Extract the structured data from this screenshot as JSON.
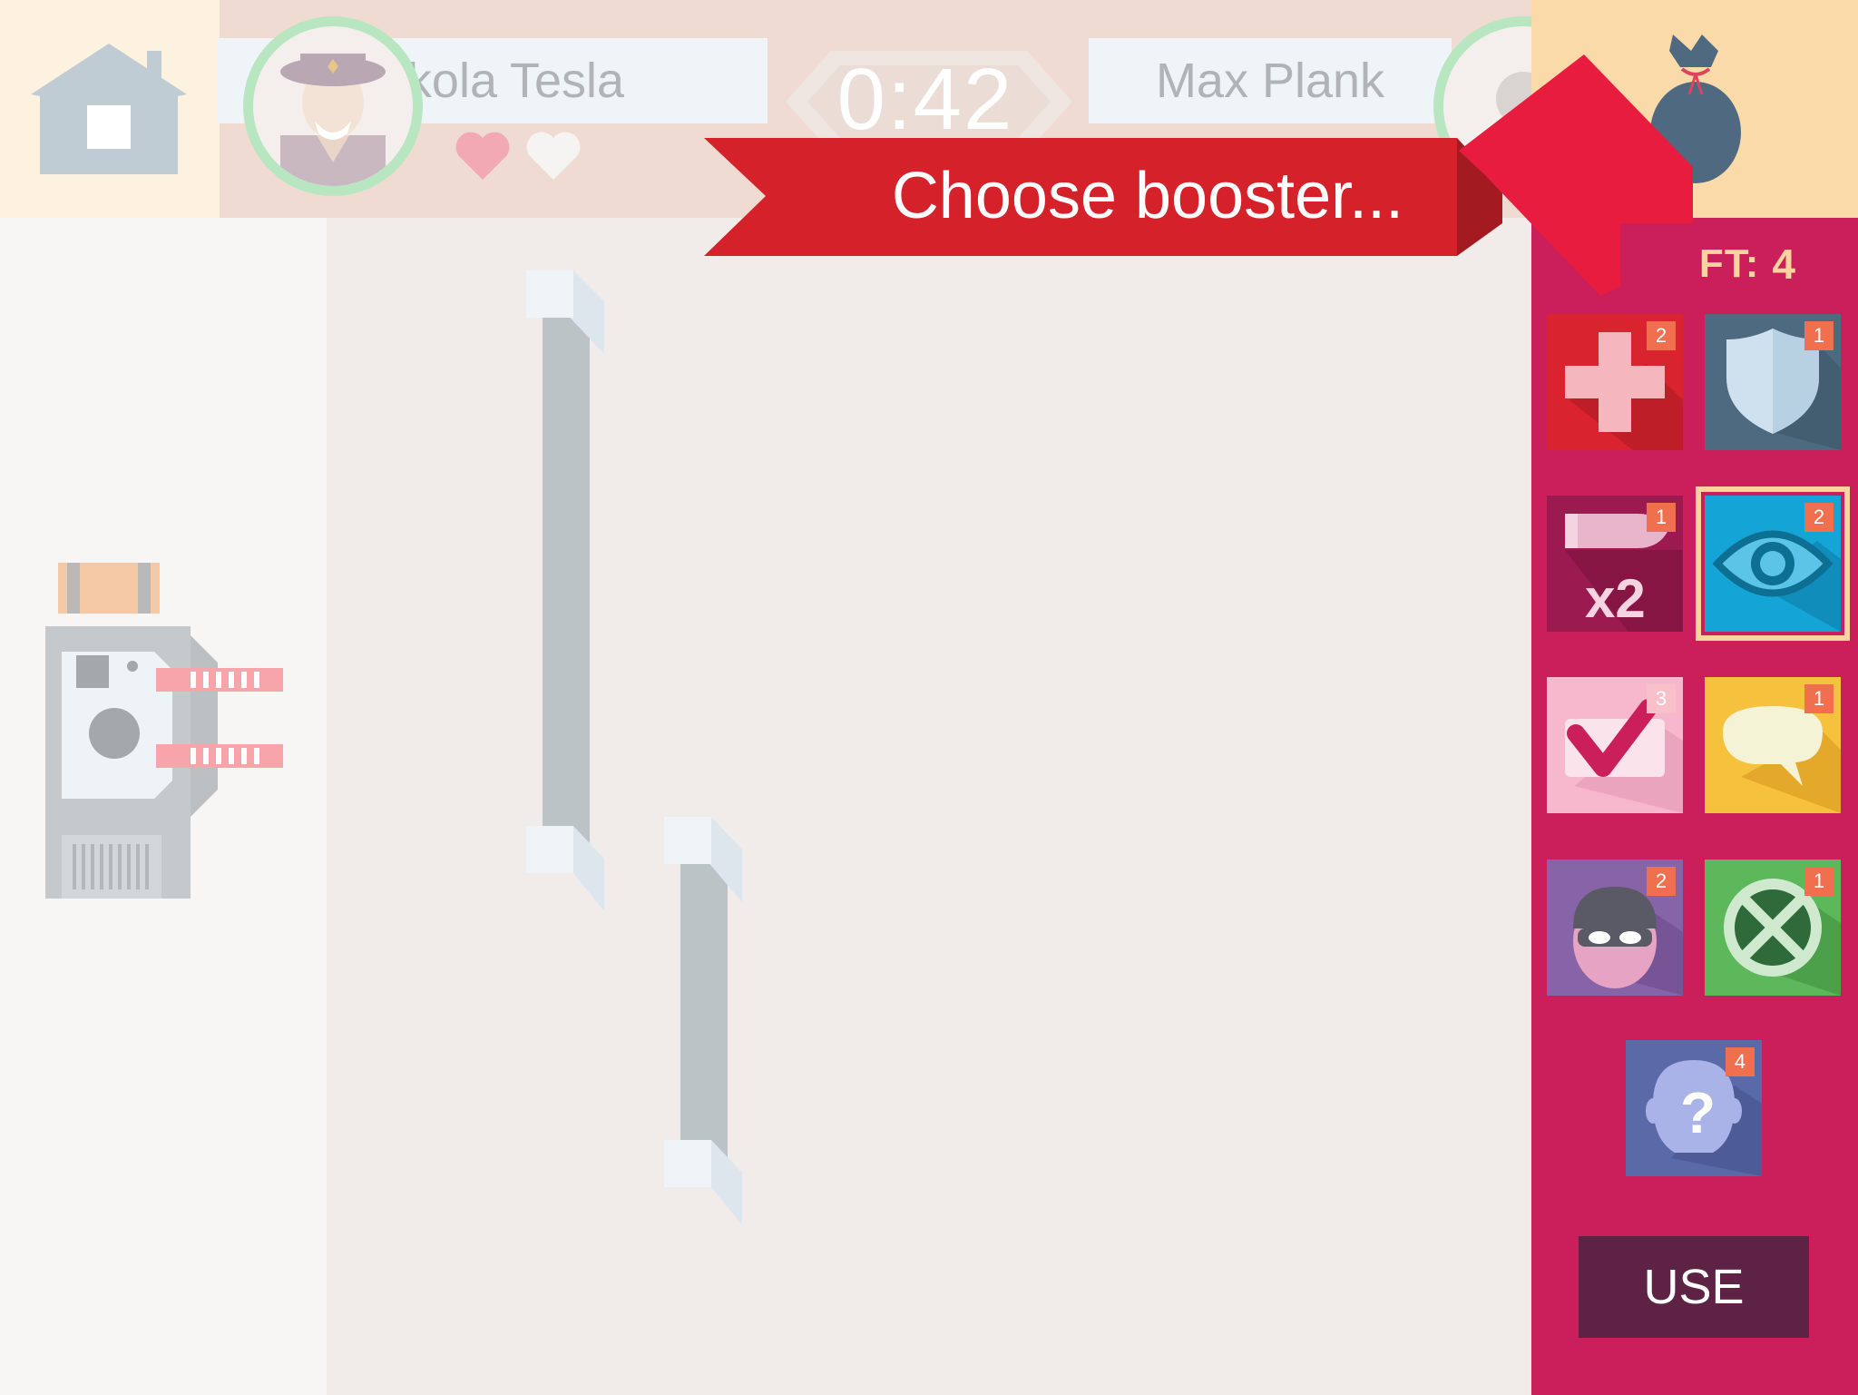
{
  "header": {
    "home_icon": "house-icon",
    "player1": {
      "name": "Nikola Tesla",
      "avatar": "officer-avatar",
      "hearts": [
        "full",
        "empty"
      ]
    },
    "timer": "0:42",
    "player2": {
      "name": "Max Plank",
      "avatar": "avatar"
    },
    "bag_icon": "money-bag-icon"
  },
  "banner": {
    "text": "Choose booster..."
  },
  "booster_panel": {
    "left_label": "FT:",
    "left_count": "4",
    "boosters": [
      {
        "icon": "medical-cross-icon",
        "count": "2",
        "color": "#d9232e"
      },
      {
        "icon": "shield-icon",
        "count": "1",
        "color": "#4e6a80"
      },
      {
        "icon": "x2-bullet-icon",
        "label": "x2",
        "count": "1",
        "color": "#9b1a4f"
      },
      {
        "icon": "eye-icon",
        "count": "2",
        "color": "#14a4d6",
        "selected": true
      },
      {
        "icon": "checkmark-ticket-icon",
        "count": "3",
        "color": "#f7b7cd"
      },
      {
        "icon": "speech-bubble-icon",
        "count": "1",
        "color": "#f6c13c"
      },
      {
        "icon": "thief-mask-icon",
        "count": "2",
        "color": "#8764a8"
      },
      {
        "icon": "cross-circle-icon",
        "count": "1",
        "color": "#5cb85a"
      },
      {
        "icon": "mystery-head-icon",
        "count": "4",
        "color": "#5a6aa8"
      }
    ],
    "use_label": "USE"
  },
  "colors": {
    "panel": "#cb1f5b",
    "banner": "#d52129",
    "use_button": "#5e2245",
    "badge": "#ef6f4f"
  }
}
